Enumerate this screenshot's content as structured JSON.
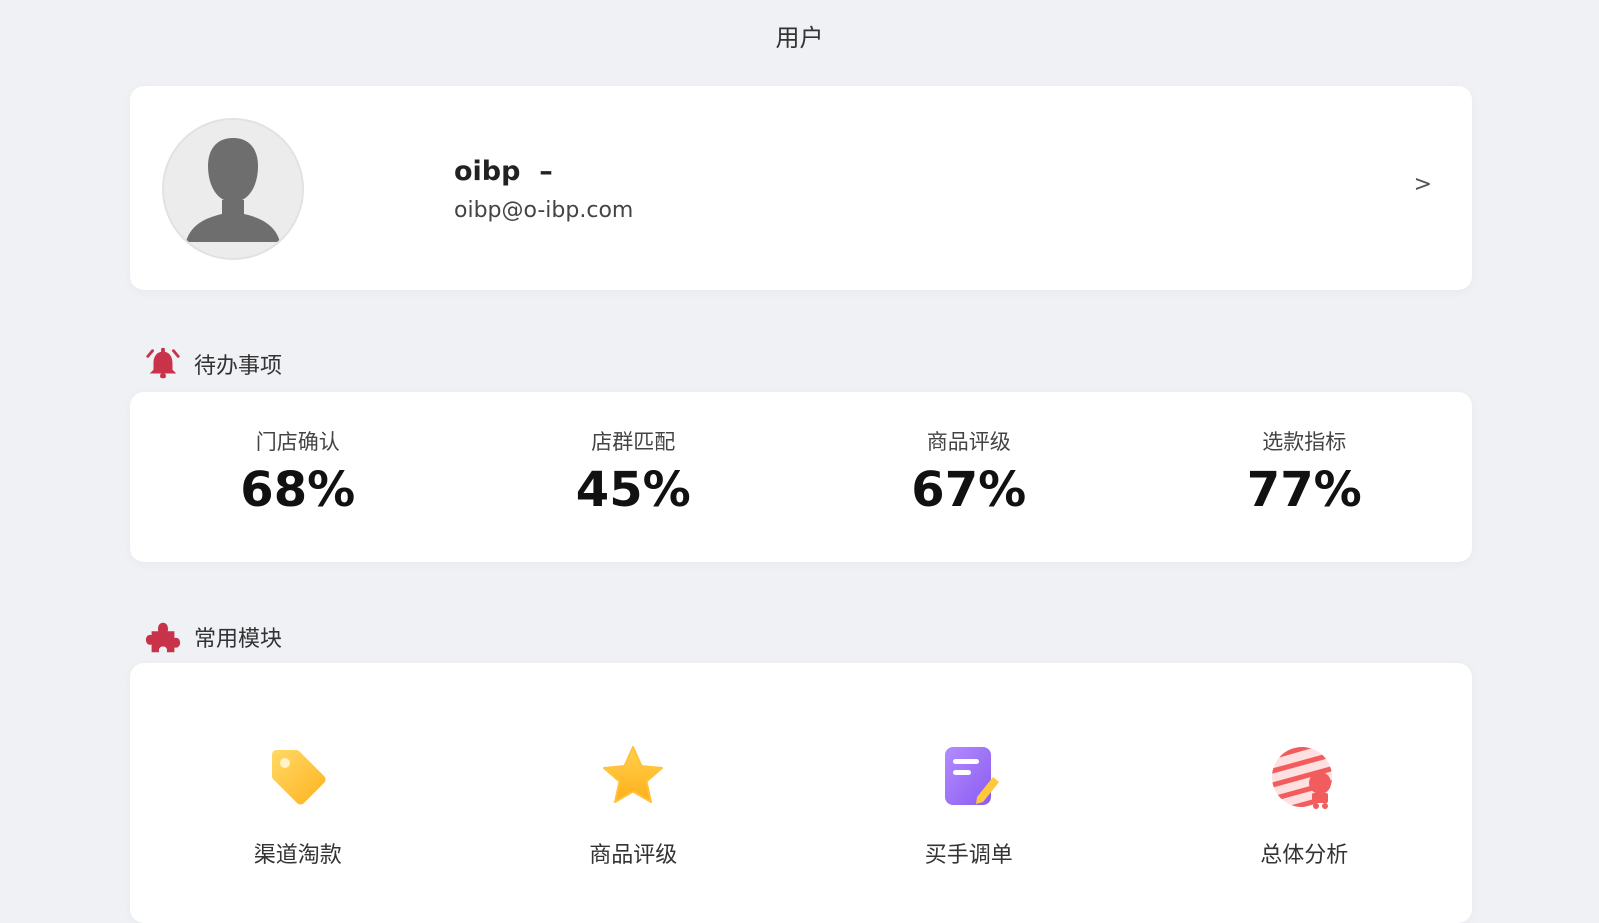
{
  "header": {
    "title": "用户"
  },
  "profile": {
    "name": "oibp  –",
    "email": "oibp@o-ibp.com",
    "chevron": ">"
  },
  "todo": {
    "title": "待办事项",
    "icon": "alarm-bell-icon",
    "items": [
      {
        "label": "门店确认",
        "value": "68%"
      },
      {
        "label": "店群匹配",
        "value": "45%"
      },
      {
        "label": "商品评级",
        "value": "67%"
      },
      {
        "label": "选款指标",
        "value": "77%"
      }
    ]
  },
  "modules": {
    "title": "常用模块",
    "icon": "puzzle-piece-icon",
    "items": [
      {
        "label": "渠道淘款",
        "icon": "tag-icon",
        "color": "#FFC83A"
      },
      {
        "label": "商品评级",
        "icon": "star-icon",
        "color": "#FFC53D"
      },
      {
        "label": "买手调单",
        "icon": "note-edit-icon",
        "color": "#9C6CF5"
      },
      {
        "label": "总体分析",
        "icon": "analysis-globe-icon",
        "color": "#F25C5C"
      }
    ]
  },
  "colors": {
    "background": "#f0f1f5",
    "accent_red": "#C8334A"
  }
}
